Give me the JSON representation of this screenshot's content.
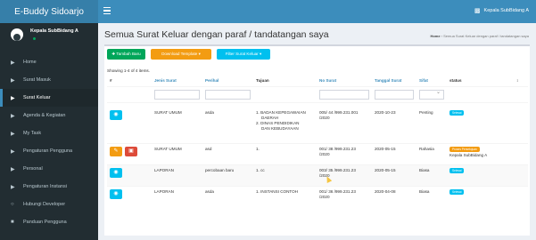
{
  "app": {
    "title": "E-Buddy Sidoarjo",
    "top_user": "Kepala SubBidang A",
    "hamburger_icon": "menu-icon",
    "user_icon": "users-icon"
  },
  "sidebar": {
    "user_name": "Kepala SubBidang A",
    "items": [
      {
        "label": "Home",
        "icon": "folder-icon",
        "active": false
      },
      {
        "label": "Surat Masuk",
        "icon": "folder-icon",
        "active": false
      },
      {
        "label": "Surat Keluar",
        "icon": "folder-icon",
        "active": true
      },
      {
        "label": "Agenda & Kegiatan",
        "icon": "folder-icon",
        "active": false
      },
      {
        "label": "My Task",
        "icon": "folder-icon",
        "active": false
      },
      {
        "label": "Pengaturan Pengguna",
        "icon": "folder-icon",
        "active": false
      },
      {
        "label": "Personal",
        "icon": "folder-icon",
        "active": false
      },
      {
        "label": "Pengaturan Instansi",
        "icon": "folder-icon",
        "active": false
      },
      {
        "label": "Hubungi Developer",
        "icon": "whatsapp-icon",
        "active": false
      },
      {
        "label": "Panduan Pengguna",
        "icon": "book-icon",
        "active": false
      }
    ]
  },
  "page": {
    "title": "Semua Surat Keluar dengan paraf / tandatangan saya",
    "breadcrumb_home": "Home",
    "breadcrumb_rest": "Semua Surat Keluar dengan paraf / tandatangan saya"
  },
  "toolbar": {
    "add_label": "✚ Tambah Baru",
    "download_label": "Download Template ▾",
    "filter_label": "Filter Surat Keluar ▾"
  },
  "showing_text": "Showing 1-4 of 4 items.",
  "table": {
    "headers": [
      "#",
      "Jenis Surat",
      "Perihal",
      "Tujuan",
      "No Surat",
      "Tanggal Surat",
      "Sifat",
      "status",
      "↕"
    ],
    "rows": [
      {
        "jenis": "SURAT UMUM",
        "perihal": "asda",
        "tujuan": [
          "1. BADAN KEPEGAWAIAN",
          "DAERAH",
          "2. DINAS PENDIDIKAN",
          "DAN KEBUDAYAAN"
        ],
        "no_surat": [
          "005/ 44 /999.231.001",
          "/2020"
        ],
        "tanggal": "2020-10-23",
        "sifat": "Penting",
        "status_badge": "Selesai",
        "status_note": ""
      },
      {
        "jenis": "SURAT UMUM",
        "perihal": "asd",
        "tujuan": [
          "1."
        ],
        "no_surat": [
          "001/ 38 /999.231.23",
          "/2020"
        ],
        "tanggal": "2020-05-15",
        "sifat": "Rahasia",
        "status_badge": "Proses Persetujuan",
        "status_note": "Kepala SubBidang A"
      },
      {
        "jenis": "LAPORAN",
        "perihal": "percobaan baru",
        "tujuan": [
          "1. cc"
        ],
        "no_surat": [
          "003/ 35 /999.231.23",
          "/2020"
        ],
        "tanggal": "2020-05-15",
        "sifat": "Biasa",
        "status_badge": "Selesai",
        "status_note": ""
      },
      {
        "jenis": "LAPORAN",
        "perihal": "asda",
        "tujuan": [
          "1. INSTANSI CONTOH"
        ],
        "no_surat": [
          "001/ 36 /999.231.23",
          "/2020"
        ],
        "tanggal": "2020-04-08",
        "sifat": "Biasa",
        "status_badge": "Selesai",
        "status_note": ""
      }
    ]
  },
  "colors": {
    "brand": "#3c8dbc",
    "sidebar": "#222d32",
    "success": "#00a65a",
    "warning": "#f39c12",
    "info": "#00c0ef",
    "danger": "#dd4b39"
  }
}
